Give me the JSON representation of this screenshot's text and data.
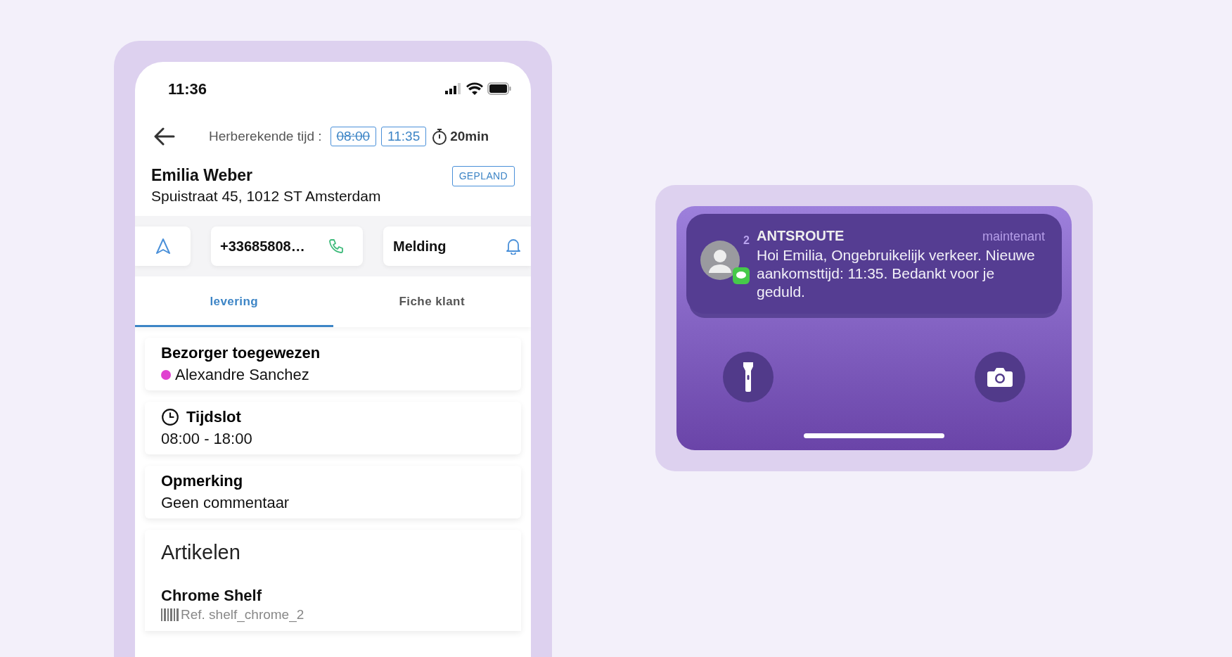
{
  "phone_app": {
    "status_bar": {
      "time": "11:36"
    },
    "header": {
      "label": "Herberekende tijd :",
      "times": [
        {
          "text": "08:00",
          "struck": true
        },
        {
          "text": "11:35",
          "struck": false
        }
      ],
      "duration": "20min"
    },
    "customer": {
      "name": "Emilia Weber",
      "address": "Spuistraat 45, 1012 ST Amsterdam",
      "status": "GEPLAND"
    },
    "actions": {
      "phone": "+33685808…",
      "alert": "Melding"
    },
    "tabs": [
      {
        "label": "levering",
        "selected": true
      },
      {
        "label": "Fiche klant",
        "selected": false
      }
    ],
    "cards": [
      {
        "kind": "assignee",
        "title": "Bezorger toegewezen",
        "value": "Alexandre Sanchez",
        "color": "#e040d0"
      },
      {
        "kind": "timeslot",
        "title": "Tijdslot",
        "value": "08:00 - 18:00"
      },
      {
        "kind": "text",
        "title": "Opmerking",
        "value": "Geen commentaar"
      }
    ],
    "articles": {
      "title": "Artikelen",
      "items": [
        {
          "name": "Chrome Shelf",
          "ref": "Ref. shelf_chrome_2"
        }
      ]
    }
  },
  "lock_screen": {
    "notification": {
      "app": "ANTSROUTE",
      "time": "maintenant",
      "count": "2",
      "message": "Hoi Emilia, Ongebruikelijk verkeer. Nieuwe aankomsttijd: 11:35. Bedankt voor je geduld."
    }
  }
}
